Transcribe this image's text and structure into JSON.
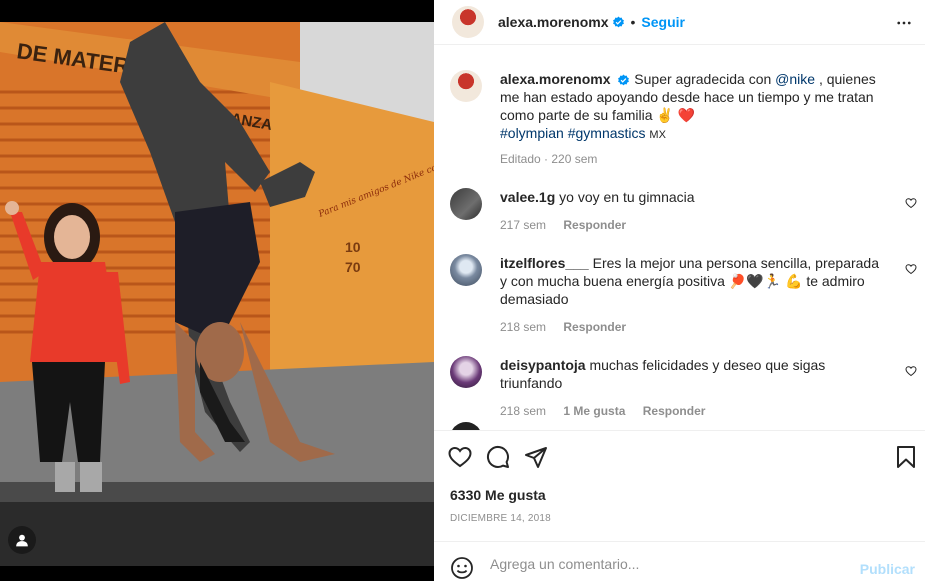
{
  "post": {
    "username": "alexa.morenomx",
    "follow_label": "Seguir",
    "caption_username": "alexa.morenomx",
    "caption_parts": {
      "pre": "Super agradecida con ",
      "mention": "@nike",
      "post": " , quienes me han estado apoyando desde hace un tiempo y me tratan como parte de su familia ✌️ ❤️",
      "tags": "#olympian #gymnastics",
      "location": "MX"
    },
    "caption_meta": "Editado · 220 sem"
  },
  "comments": [
    {
      "user": "valee.1g",
      "text": "yo voy en tu gimnacia",
      "age": "217 sem",
      "likes": "",
      "reply": "Responder"
    },
    {
      "user": "itzelflores___",
      "text": "Eres la mejor una persona sencilla, preparada y con mucha buena energía positiva 🏓🖤🏃 💪  te admiro demasiado",
      "age": "218 sem",
      "likes": "",
      "reply": "Responder"
    },
    {
      "user": "deisypantoja",
      "text": "muchas felicidades y deseo que sigas triunfando",
      "age": "218 sem",
      "likes": "1 Me gusta",
      "reply": "Responder"
    }
  ],
  "actions": {
    "likes": "6330 Me gusta",
    "date": "DICIEMBRE 14, 2018"
  },
  "compose": {
    "placeholder": "Agrega un comentario...",
    "publish": "Publicar"
  },
  "photo_text": {
    "sign_top": "DE MATER",
    "sign_mid": "ESPERANZA",
    "signature": "Para mis amigos de Nike con mucho cariño Gracias"
  },
  "colors": {
    "accent": "#0095f6",
    "link": "#00376b",
    "muted": "#8e8e8e",
    "publish_disabled": "#b2dffc"
  },
  "icons": [
    "more-icon",
    "verified-icon",
    "heart-icon",
    "comment-icon",
    "share-icon",
    "bookmark-icon",
    "emoji-icon",
    "user-tag-icon"
  ]
}
